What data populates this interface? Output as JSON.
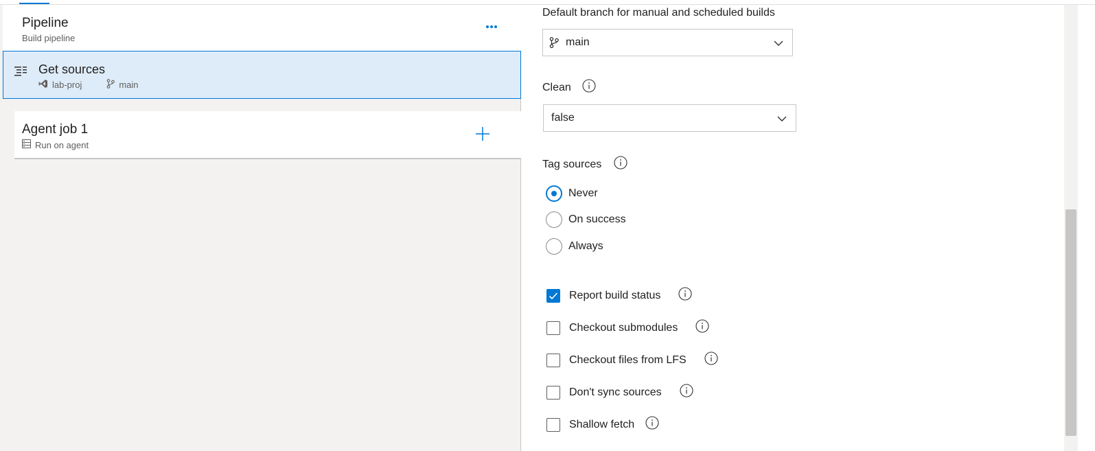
{
  "left": {
    "pipeline": {
      "title": "Pipeline",
      "subtitle": "Build pipeline",
      "more_icon": "more-ellipsis-icon"
    },
    "get_sources": {
      "title": "Get sources",
      "icon": "list-icon",
      "repo": "lab-proj",
      "repo_icon": "visual-studio-icon",
      "branch": "main",
      "branch_icon": "branch-icon"
    },
    "agent_job": {
      "title": "Agent job 1",
      "subtitle": "Run on agent",
      "subtitle_icon": "server-icon",
      "add_icon": "plus-icon"
    }
  },
  "right": {
    "default_branch": {
      "label": "Default branch for manual and scheduled builds",
      "value": "main"
    },
    "clean": {
      "label": "Clean",
      "value": "false"
    },
    "tag_sources": {
      "label": "Tag sources",
      "options": [
        "Never",
        "On success",
        "Always"
      ],
      "selected": "Never"
    },
    "checkboxes": [
      {
        "label": "Report build status",
        "checked": true
      },
      {
        "label": "Checkout submodules",
        "checked": false
      },
      {
        "label": "Checkout files from LFS",
        "checked": false
      },
      {
        "label": "Don't sync sources",
        "checked": false
      },
      {
        "label": "Shallow fetch",
        "checked": false
      }
    ]
  },
  "colors": {
    "accent": "#0078d4",
    "selected_bg": "#deecf9",
    "pane_bg": "#f3f2f1"
  }
}
